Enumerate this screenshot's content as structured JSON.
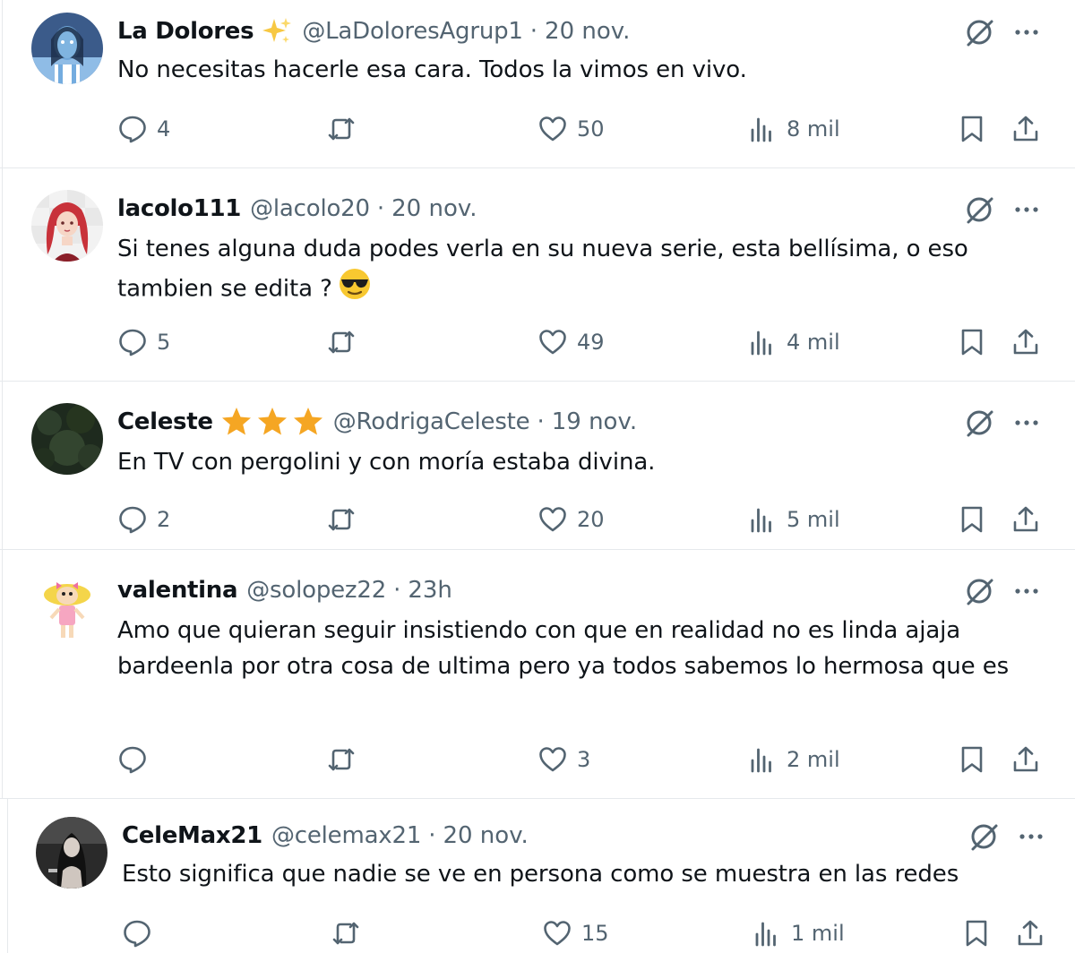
{
  "tweets": [
    {
      "name": "La Dolores",
      "badge": "sparkles-icon",
      "handle": "@LaDoloresAgrup1",
      "separator": "·",
      "time": "20 nov.",
      "text": "No necesitas hacerle esa cara. Todos la vimos en vivo.",
      "replies": "4",
      "retweets": "",
      "likes": "50",
      "views": "8 mil"
    },
    {
      "name": "lacolo111",
      "badge": "",
      "handle": "@lacolo20",
      "separator": "·",
      "time": "20 nov.",
      "text": "Si tenes alguna duda podes verla en su nueva serie, esta bellísima, o eso tambien se edita ?",
      "emoji": "sunglasses-face-icon",
      "replies": "5",
      "retweets": "",
      "likes": "49",
      "views": "4 mil"
    },
    {
      "name": "Celeste",
      "badge": "three-stars-icon",
      "handle": "@RodrigaCeleste",
      "separator": "·",
      "time": "19 nov.",
      "text": "En TV con pergolini y con moría estaba divina.",
      "replies": "2",
      "retweets": "",
      "likes": "20",
      "views": "5 mil"
    },
    {
      "name": "valentina",
      "badge": "",
      "handle": "@solopez22",
      "separator": "·",
      "time": "23h",
      "text": "Amo que quieran seguir insistiendo con que en realidad no es linda ajaja bardeenla por otra cosa de ultima pero ya todos sabemos lo hermosa que es",
      "replies": "",
      "retweets": "",
      "likes": "3",
      "views": "2 mil"
    },
    {
      "name": "CeleMax21",
      "badge": "",
      "handle": "@celemax21",
      "separator": "·",
      "time": "20 nov.",
      "text": "Esto significa que nadie se ve en persona como se muestra en las redes",
      "replies": "",
      "retweets": "",
      "likes": "15",
      "views": "1 mil"
    }
  ],
  "colors": {
    "text": "#0f1419",
    "secondary": "#536471",
    "divider": "#e6e9ec",
    "star": "#f5a623"
  }
}
